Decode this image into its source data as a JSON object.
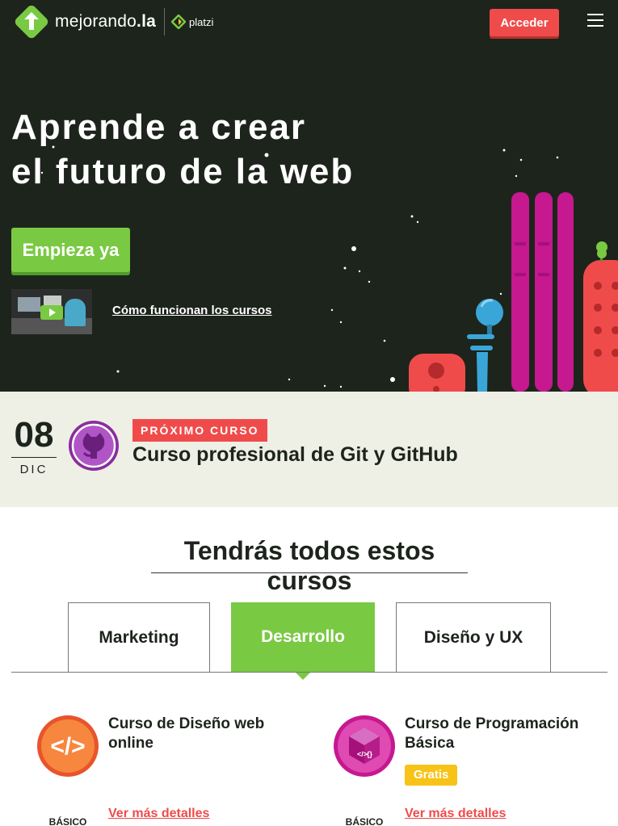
{
  "header": {
    "logo_text_main": "mejorando",
    "logo_text_suffix": ".la",
    "partner": "platzi",
    "login_label": "Acceder"
  },
  "hero": {
    "title_line1": "Aprende a crear",
    "title_line2": "el futuro de la web",
    "cta_label": "Empieza ya",
    "video_link": "Cómo funcionan los cursos"
  },
  "next_course": {
    "day": "08",
    "month": "DIC",
    "label": "PRÓXIMO CURSO",
    "title": "Curso profesional de Git y GitHub"
  },
  "courses_section": {
    "title": "Tendrás todos estos cursos",
    "tabs": [
      {
        "label": "Marketing",
        "active": false
      },
      {
        "label": "Desarrollo",
        "active": true
      },
      {
        "label": "Diseño y UX",
        "active": false
      }
    ],
    "cards": [
      {
        "title_line1": "Curso de Diseño web",
        "title_line2": "online",
        "level": "BÁSICO",
        "link": "Ver más detalles",
        "badge": ""
      },
      {
        "title_line1": "Curso de Programación",
        "title_line2": "Básica",
        "level": "BÁSICO",
        "link": "Ver más detalles",
        "badge": "Gratis"
      }
    ]
  },
  "colors": {
    "hero_bg": "#1d241c",
    "accent_green": "#7ac943",
    "accent_red": "#f04b4b",
    "badge_yellow": "#f7c318",
    "next_bg": "#eef0e6"
  }
}
